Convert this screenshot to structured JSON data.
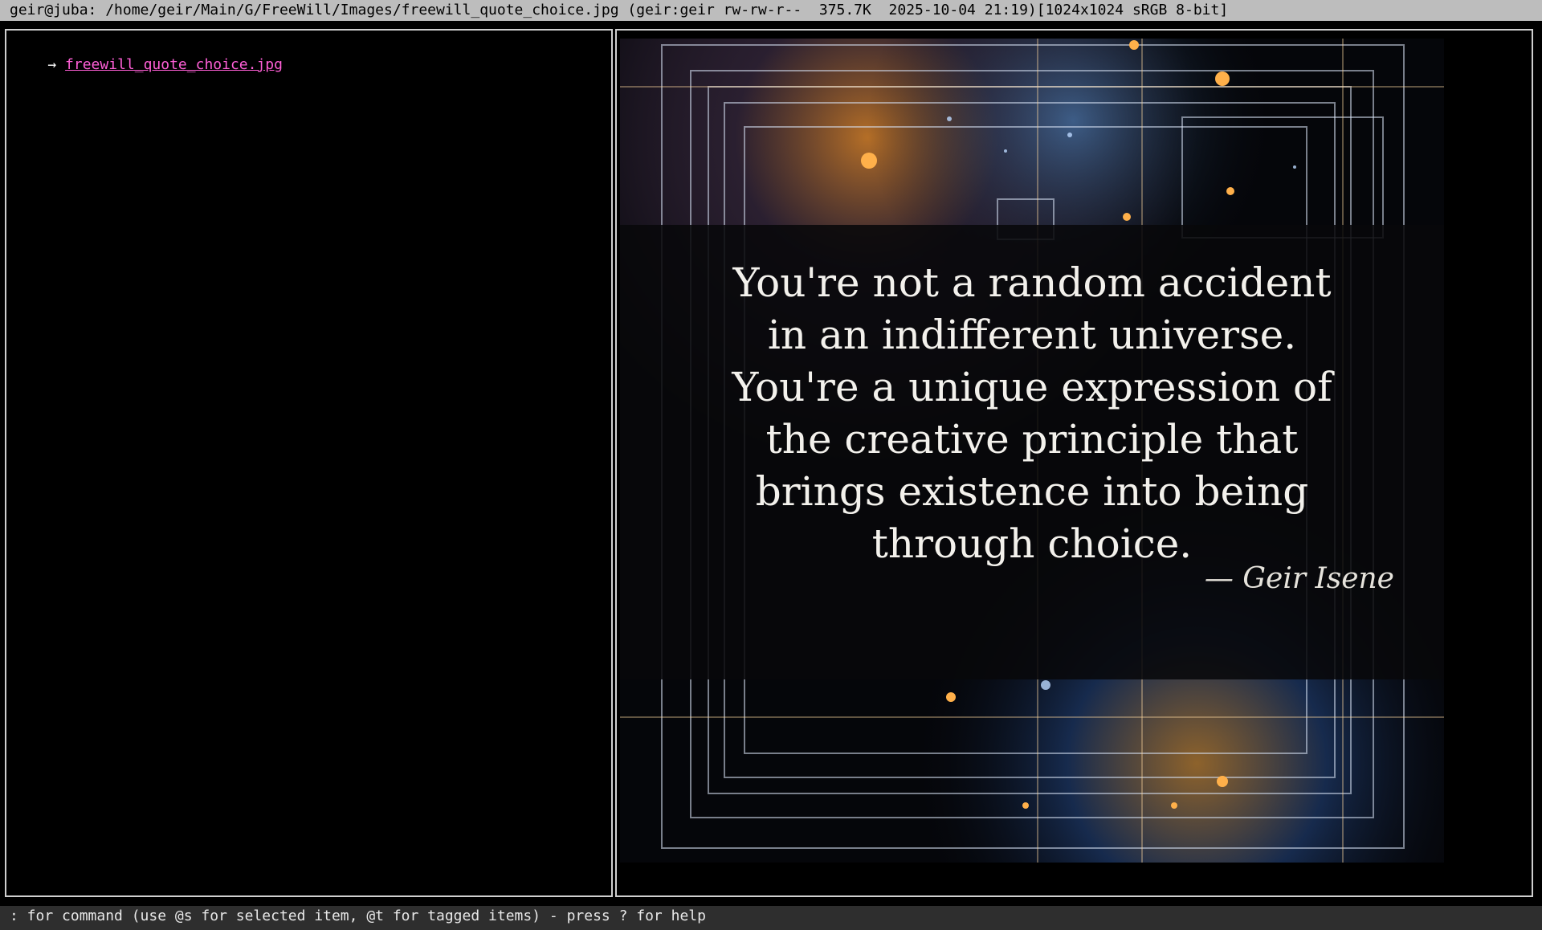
{
  "titlebar": {
    "text": "geir@juba: /home/geir/Main/G/FreeWill/Images/freewill_quote_choice.jpg (geir:geir rw-rw-r--  375.7K  2025-10-04 21:19)[1024x1024 sRGB 8-bit]"
  },
  "file_list": {
    "items": [
      {
        "arrow": "→ ",
        "name": "freewill_quote_choice.jpg"
      }
    ]
  },
  "preview": {
    "quote_lines": [
      "You're not a random accident",
      "in an indifferent universe.",
      "You're a unique expression of",
      "the creative principle that",
      "brings existence into being",
      "through choice."
    ],
    "attribution": "— Geir Isene"
  },
  "statusbar": {
    "text": ": for command (use @s for selected item, @t for tagged items) - press ? for help"
  },
  "colors": {
    "titlebar_bg": "#bdbdbd",
    "filename": "#ff5fd7",
    "statusbar_bg": "#2e2e2e",
    "background": "#000000"
  }
}
